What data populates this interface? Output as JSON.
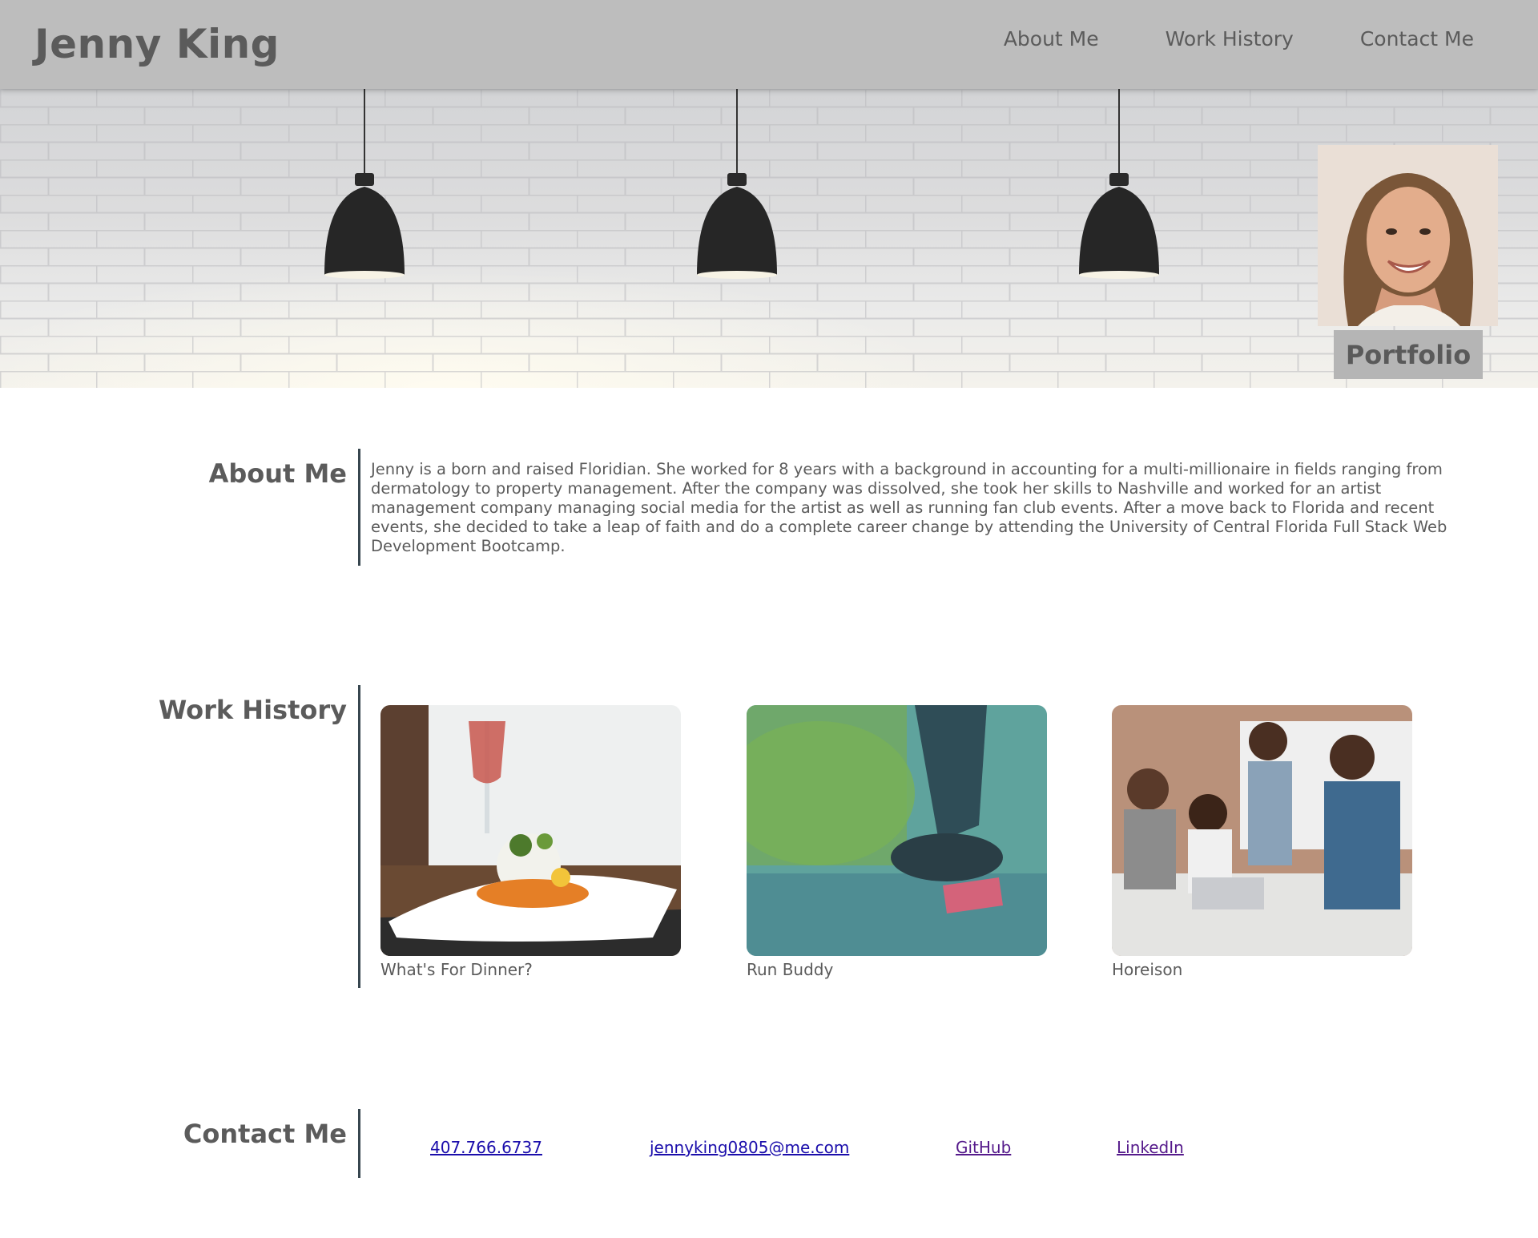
{
  "header": {
    "brand": "Jenny King",
    "nav": [
      "About Me",
      "Work History",
      "Contact Me"
    ]
  },
  "hero": {
    "portfolio_label": "Portfolio"
  },
  "about": {
    "title": "About Me",
    "text": "Jenny is a born and raised Floridian. She worked for 8 years with a background in accounting for a multi-millionaire in fields ranging from dermatology to property management. After the company was dissolved, she took her skills to Nashville and worked for an artist management company managing social media for the artist as well as running fan club events. After a move back to Florida and recent events, she decided to take a leap of faith and do a complete career change by attending the University of Central Florida Full Stack Web Development Bootcamp."
  },
  "work": {
    "title": "Work History",
    "projects": [
      {
        "name": "What's For Dinner?"
      },
      {
        "name": "Run Buddy"
      },
      {
        "name": "Horeison"
      }
    ]
  },
  "contact": {
    "title": "Contact Me",
    "links": [
      "407.766.6737",
      "jennyking0805@me.com",
      "GitHub",
      "LinkedIn"
    ]
  },
  "colors": {
    "header_bg": "#bdbdbd",
    "text": "#5b5b5b",
    "divider": "#37464f",
    "link": "#1a0dab",
    "link_visited": "#551a8b"
  }
}
